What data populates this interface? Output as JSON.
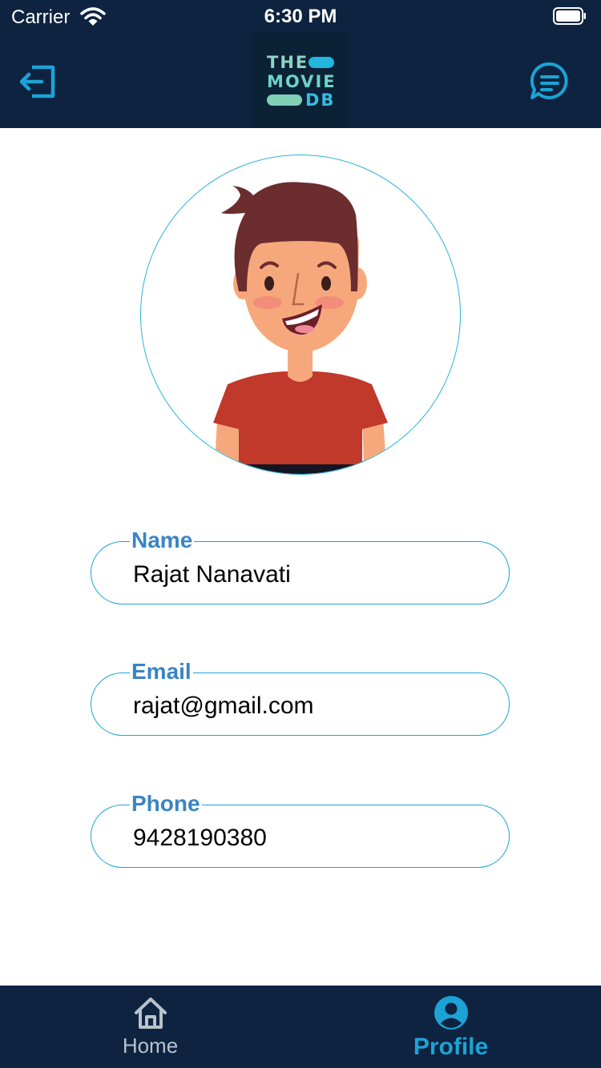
{
  "status_bar": {
    "carrier": "Carrier",
    "time": "6:30 PM"
  },
  "header": {
    "logo": {
      "line1": "THE",
      "line2": "MOVIE",
      "line3": "DB"
    },
    "logout_icon": "logout-icon",
    "chat_icon": "chat-icon"
  },
  "profile": {
    "fields": [
      {
        "label": "Name",
        "value": "Rajat Nanavati"
      },
      {
        "label": "Email",
        "value": "rajat@gmail.com"
      },
      {
        "label": "Phone",
        "value": "9428190380"
      }
    ]
  },
  "tab_bar": {
    "tabs": [
      {
        "label": "Home",
        "icon": "home-icon",
        "active": false
      },
      {
        "label": "Profile",
        "icon": "person-icon",
        "active": true
      }
    ]
  },
  "colors": {
    "nav_background": "#0d2340",
    "accent": "#1ca3d6",
    "label": "#3a84c6",
    "inactive_tab": "#b9c2cc"
  }
}
